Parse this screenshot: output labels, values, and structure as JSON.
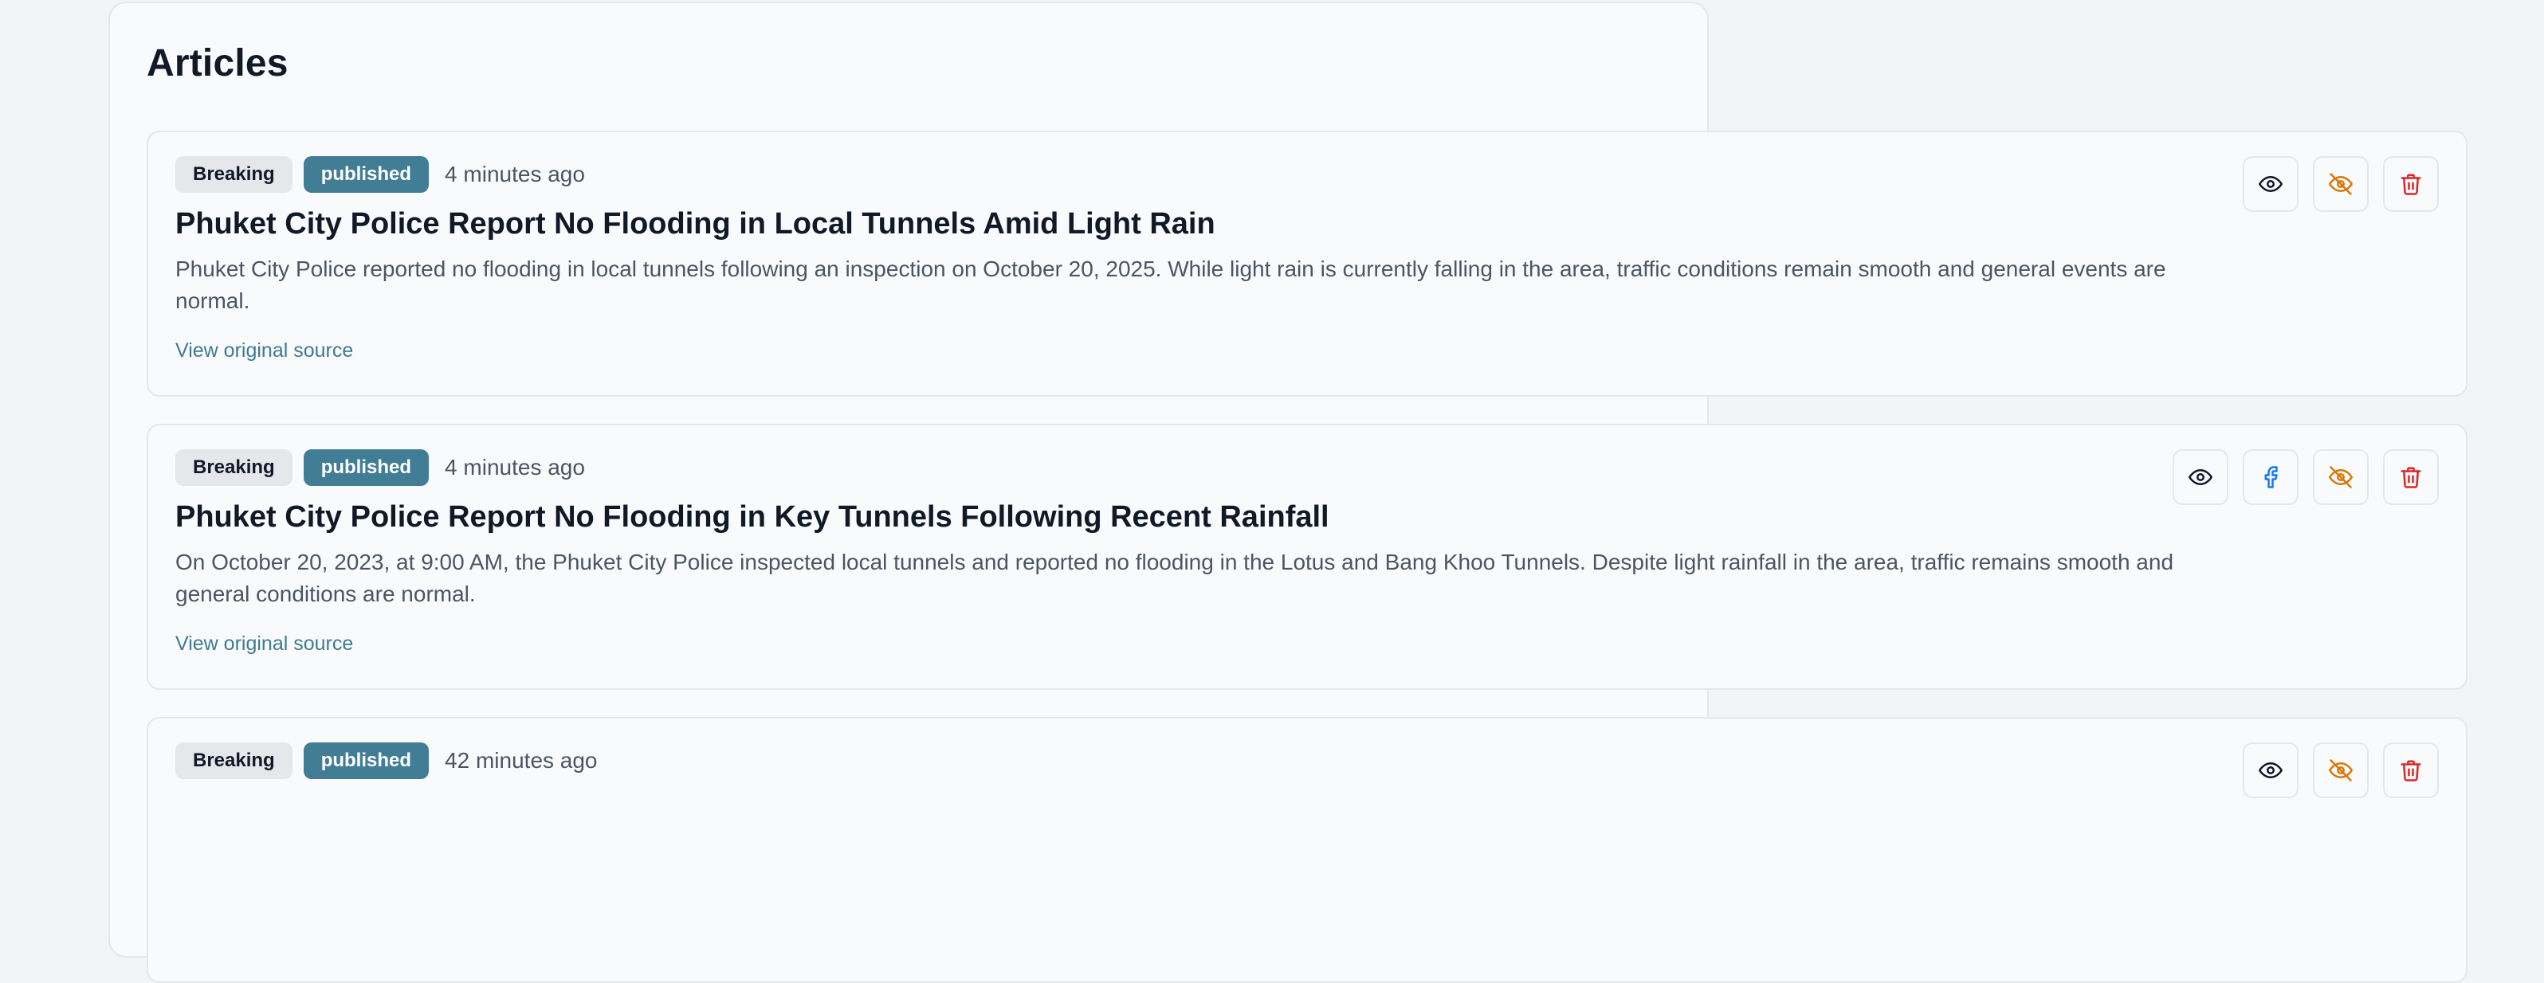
{
  "page": {
    "title": "Articles"
  },
  "articles": [
    {
      "category": "Breaking",
      "status": "published",
      "time": "4 minutes ago",
      "title": "Phuket City Police Report No Flooding in Local Tunnels Amid Light Rain",
      "summary": "Phuket City Police reported no flooding in local tunnels following an inspection on October 20, 2025. While light rain is currently falling in the area, traffic conditions remain smooth and general events are normal.",
      "link": "View original source",
      "actions": [
        "eye-icon",
        "eye-off-icon",
        "trash-icon"
      ]
    },
    {
      "category": "Breaking",
      "status": "published",
      "time": "4 minutes ago",
      "title": "Phuket City Police Report No Flooding in Key Tunnels Following Recent Rainfall",
      "summary": "On October 20, 2023, at 9:00 AM, the Phuket City Police inspected local tunnels and reported no flooding in the Lotus and Bang Khoo Tunnels. Despite light rainfall in the area, traffic remains smooth and general conditions are normal.",
      "link": "View original source",
      "actions": [
        "eye-icon",
        "facebook-icon",
        "eye-off-icon",
        "trash-icon"
      ]
    },
    {
      "category": "Breaking",
      "status": "published",
      "time": "42 minutes ago",
      "title": "",
      "summary": "",
      "link": "",
      "actions": [
        "eye-icon",
        "eye-off-icon",
        "trash-icon"
      ]
    }
  ],
  "colors": {
    "accent": "#427d96",
    "link": "#3f7a92",
    "hide": "#d97706",
    "delete": "#dc2626",
    "facebook": "#1877f2"
  }
}
